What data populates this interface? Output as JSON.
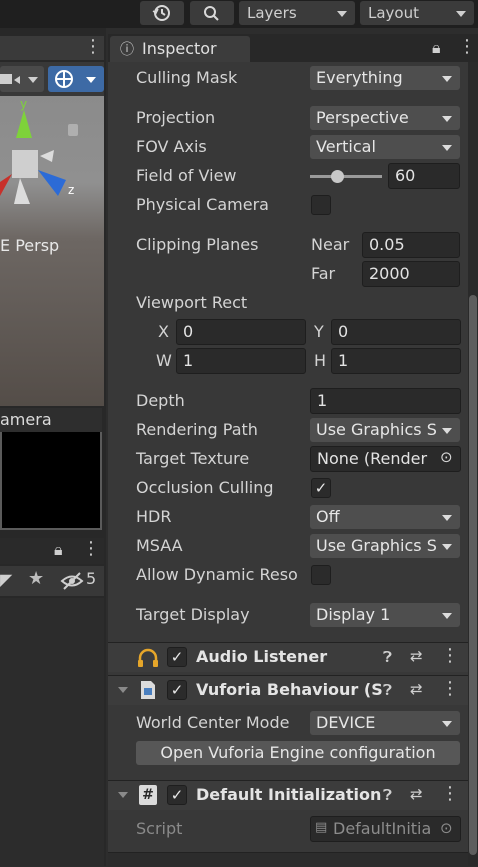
{
  "toolbar": {
    "layers_label": "Layers",
    "layout_label": "Layout"
  },
  "scene": {
    "gizmo_y": "y",
    "gizmo_z": "z",
    "persp_label": "E Persp",
    "camera_preview_title": "amera"
  },
  "hierarchy": {
    "hidden_count": "5"
  },
  "inspector": {
    "tab_label": "Inspector",
    "culling_mask": {
      "label": "Culling Mask",
      "value": "Everything"
    },
    "projection": {
      "label": "Projection",
      "value": "Perspective"
    },
    "fov_axis": {
      "label": "FOV Axis",
      "value": "Vertical"
    },
    "field_of_view": {
      "label": "Field of View",
      "value": "60",
      "slider_fraction": 0.38
    },
    "physical_camera": {
      "label": "Physical Camera",
      "checked": false
    },
    "clipping_planes": {
      "label": "Clipping Planes",
      "near_label": "Near",
      "near": "0.05",
      "far_label": "Far",
      "far": "2000"
    },
    "viewport_rect": {
      "label": "Viewport Rect",
      "x_label": "X",
      "x": "0",
      "y_label": "Y",
      "y": "0",
      "w_label": "W",
      "w": "1",
      "h_label": "H",
      "h": "1"
    },
    "depth": {
      "label": "Depth",
      "value": "1"
    },
    "rendering_path": {
      "label": "Rendering Path",
      "value": "Use Graphics S"
    },
    "target_texture": {
      "label": "Target Texture",
      "value": "None (Render"
    },
    "occlusion_culling": {
      "label": "Occlusion Culling",
      "check": "✓"
    },
    "hdr": {
      "label": "HDR",
      "value": "Off"
    },
    "msaa": {
      "label": "MSAA",
      "value": "Use Graphics S"
    },
    "allow_dynamic": {
      "label": "Allow Dynamic Reso",
      "checked": false
    },
    "target_display": {
      "label": "Target Display",
      "value": "Display 1"
    }
  },
  "components": {
    "audio_listener": {
      "title": "Audio Listener",
      "check": "✓"
    },
    "vuforia": {
      "title": "Vuforia Behaviour (S",
      "check": "✓",
      "world_center_label": "World Center Mode",
      "world_center_value": "DEVICE",
      "config_button": "Open Vuforia Engine configuration"
    },
    "default_init": {
      "title": "Default Initialization",
      "check": "✓",
      "script_label": "Script",
      "script_value": "DefaultInitia"
    }
  },
  "colors": {
    "gizmo_green": "#7ed23a",
    "gizmo_blue": "#2c6bd6",
    "gizmo_red": "#c8302a",
    "gizmo_yellow": "#e0c030",
    "audio_icon": "#e6a62a"
  }
}
